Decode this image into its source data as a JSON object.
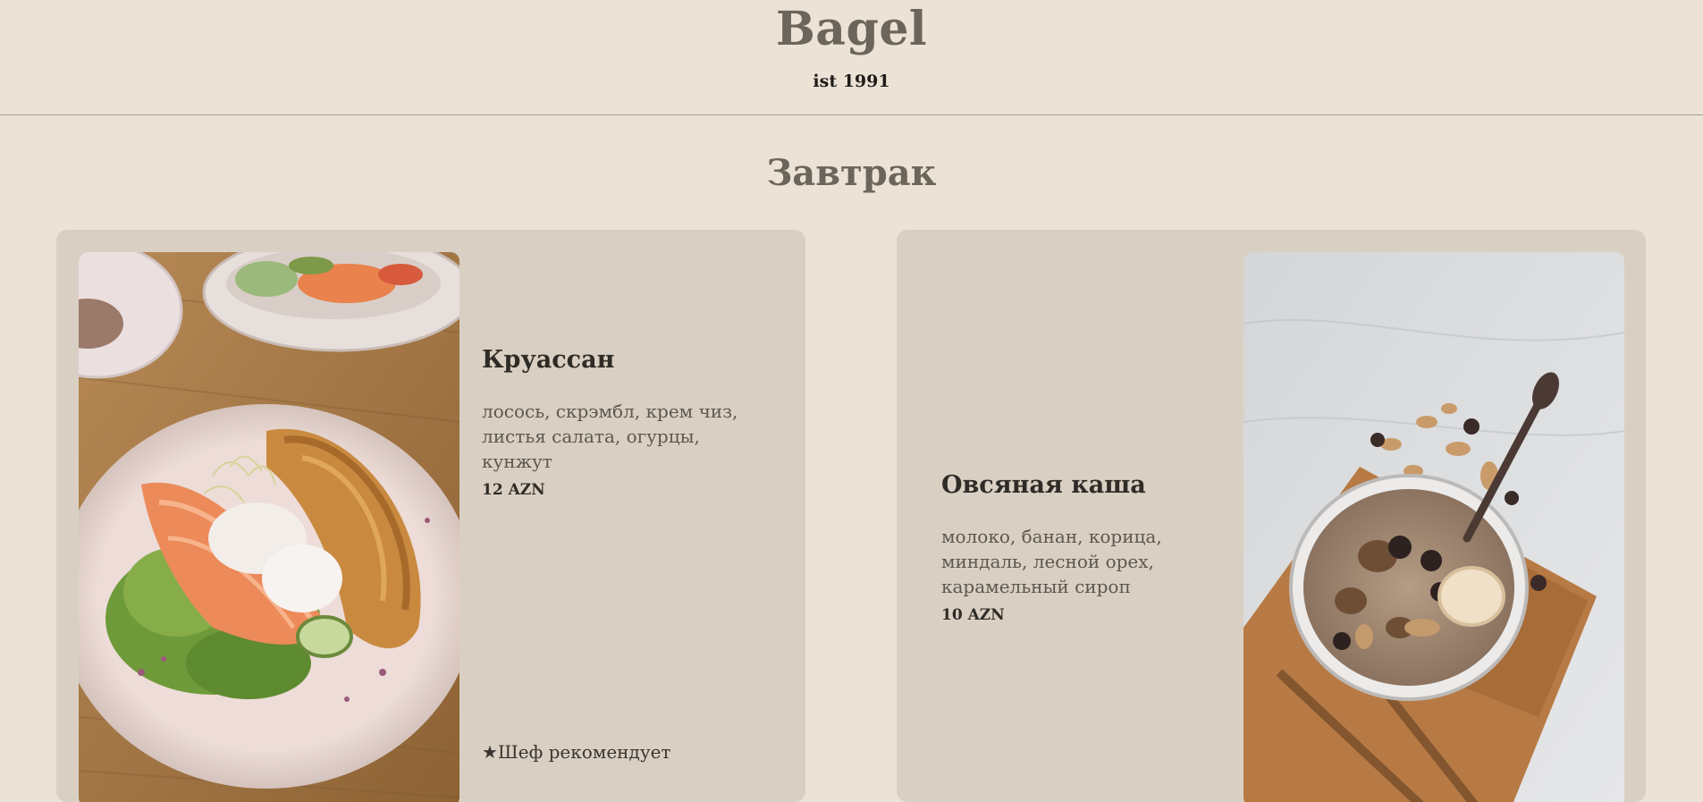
{
  "header": {
    "brand": "Bagel",
    "est": "ist 1991"
  },
  "section": {
    "title": "Завтрак"
  },
  "menu_items": [
    {
      "name": "Круассан",
      "description": "лосось, скрэмбл, крем чиз, листья салата, огурцы, кунжут",
      "price": "12 AZN",
      "badge": "★Шеф рекомендует",
      "image_icon": "croissant-salmon-photo"
    },
    {
      "name": "Овсяная каша",
      "description": "молоко, банан, корица, миндаль, лесной орех, карамельный сироп",
      "price": "10 AZN",
      "image_icon": "oatmeal-bowl-photo"
    }
  ],
  "colors": {
    "background": "#ece3d6",
    "card": "#d9d0c3",
    "brand": "#6b655b",
    "text": "#2f2b26"
  }
}
